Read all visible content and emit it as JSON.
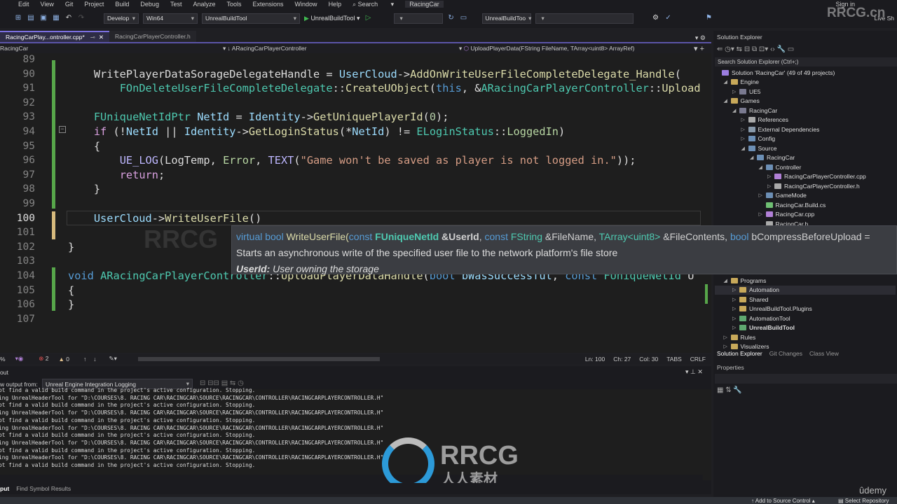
{
  "menu": {
    "items": [
      "Edit",
      "View",
      "Git",
      "Project",
      "Build",
      "Debug",
      "Test",
      "Analyze",
      "Tools",
      "Extensions",
      "Window",
      "Help"
    ],
    "search": "Search",
    "title": "RacingCar",
    "sign_in": "Sign in",
    "live_share": "Live Sh"
  },
  "toolbar": {
    "config": "Develop",
    "platform": "Win64",
    "startup": "UnrealBuildTool",
    "run_label": "UnrealBuildTool",
    "target2": "UnrealBuildToo"
  },
  "tabs": [
    {
      "label": "RacingCarPlay...ontroller.cpp*",
      "active": true
    },
    {
      "label": "RacingCarPlayerController.h",
      "active": false
    }
  ],
  "navbar": {
    "project": "RacingCar",
    "class": "ARacingCarPlayerController",
    "member": "UploadPlayerData(FString FileName, TArray<uint8> ArrayRef)"
  },
  "colors": {
    "p": "#dcdcdc",
    "v": "#9cdcfe",
    "f": "#dcdcaa",
    "t": "#4ec9b0",
    "k": "#569cd6",
    "c": "#d8a0df",
    "m": "#beb7ff",
    "s": "#d69d85",
    "n": "#b5cea8",
    "e": "#b8d7a3",
    "accent": "#7b6fe0"
  },
  "editor": {
    "current_line": 100,
    "lines": [
      {
        "n": 89,
        "t": []
      },
      {
        "n": 90,
        "t": [
          [
            "    WritePlayerDataSorageDelegateHandle",
            "p"
          ],
          [
            " = ",
            "p"
          ],
          [
            "UserCloud",
            "v"
          ],
          [
            "->",
            "p"
          ],
          [
            "AddOnWriteUserFileCompleteDelegate_Handle",
            "f"
          ],
          [
            "(",
            "p"
          ]
        ]
      },
      {
        "n": 91,
        "t": [
          [
            "        ",
            "p"
          ],
          [
            "FOnDeleteUserFileCompleteDelegate",
            "t"
          ],
          [
            "::",
            "p"
          ],
          [
            "CreateUObject",
            "f"
          ],
          [
            "(",
            "p"
          ],
          [
            "this",
            "k"
          ],
          [
            ", &",
            "p"
          ],
          [
            "ARacingCarPlayerController",
            "t"
          ],
          [
            "::",
            "p"
          ],
          [
            "Upload",
            "f"
          ]
        ]
      },
      {
        "n": 92,
        "t": []
      },
      {
        "n": 93,
        "t": [
          [
            "    ",
            "p"
          ],
          [
            "FUniqueNetIdPtr",
            "t"
          ],
          [
            " ",
            "p"
          ],
          [
            "NetId",
            "v"
          ],
          [
            " = ",
            "p"
          ],
          [
            "Identity",
            "v"
          ],
          [
            "->",
            "p"
          ],
          [
            "GetUniquePlayerId",
            "f"
          ],
          [
            "(",
            "p"
          ],
          [
            "0",
            "n"
          ],
          [
            ");",
            "p"
          ]
        ]
      },
      {
        "n": 94,
        "t": [
          [
            "    ",
            "p"
          ],
          [
            "if",
            "c"
          ],
          [
            " (!",
            "p"
          ],
          [
            "NetId",
            "v"
          ],
          [
            " || ",
            "p"
          ],
          [
            "Identity",
            "v"
          ],
          [
            "->",
            "p"
          ],
          [
            "GetLoginStatus",
            "f"
          ],
          [
            "(*",
            "p"
          ],
          [
            "NetId",
            "v"
          ],
          [
            ") != ",
            "p"
          ],
          [
            "ELoginStatus",
            "t"
          ],
          [
            "::",
            "p"
          ],
          [
            "LoggedIn",
            "e"
          ],
          [
            ")",
            "p"
          ]
        ]
      },
      {
        "n": 95,
        "t": [
          [
            "    {",
            "p"
          ]
        ]
      },
      {
        "n": 96,
        "t": [
          [
            "        ",
            "p"
          ],
          [
            "UE_LOG",
            "m"
          ],
          [
            "(",
            "p"
          ],
          [
            "LogTemp",
            "p"
          ],
          [
            ", ",
            "p"
          ],
          [
            "Error",
            "e"
          ],
          [
            ", ",
            "p"
          ],
          [
            "TEXT",
            "m"
          ],
          [
            "(",
            "p"
          ],
          [
            "\"Game won't be saved as player is not logged in.\"",
            "s"
          ],
          [
            "));",
            "p"
          ]
        ]
      },
      {
        "n": 97,
        "t": [
          [
            "        ",
            "p"
          ],
          [
            "return",
            "c"
          ],
          [
            ";",
            "p"
          ]
        ]
      },
      {
        "n": 98,
        "t": [
          [
            "    }",
            "p"
          ]
        ]
      },
      {
        "n": 99,
        "t": []
      },
      {
        "n": 100,
        "t": [
          [
            "    ",
            "p"
          ],
          [
            "UserCloud",
            "v"
          ],
          [
            "->",
            "p"
          ],
          [
            "WriteUserFile",
            "f"
          ],
          [
            "()",
            "p"
          ]
        ]
      },
      {
        "n": 101,
        "t": []
      },
      {
        "n": 102,
        "t": [
          [
            "}",
            "p"
          ]
        ]
      },
      {
        "n": 103,
        "t": []
      },
      {
        "n": 104,
        "t": [
          [
            "void",
            "k"
          ],
          [
            " ",
            "p"
          ],
          [
            "ARacingCarPlayerController",
            "t"
          ],
          [
            "::",
            "p"
          ],
          [
            "UploadPlayerDataHandle",
            "f"
          ],
          [
            "(",
            "p"
          ],
          [
            "bool",
            "k"
          ],
          [
            " ",
            "p"
          ],
          [
            "bWasSuccessful",
            "v"
          ],
          [
            ", ",
            "p"
          ],
          [
            "const",
            "k"
          ],
          [
            " ",
            "p"
          ],
          [
            "FUniqueNetId",
            "t"
          ],
          [
            " U",
            "p"
          ]
        ]
      },
      {
        "n": 105,
        "t": [
          [
            "{",
            "p"
          ]
        ]
      },
      {
        "n": 106,
        "t": [
          [
            "}",
            "p"
          ]
        ]
      },
      {
        "n": 107,
        "t": []
      }
    ]
  },
  "tooltip": {
    "signature": [
      [
        "virtual bool ",
        "k"
      ],
      [
        "WriteUserFile",
        "f"
      ],
      [
        "(",
        "f"
      ],
      [
        "const ",
        "k"
      ],
      [
        "FUniqueNetId",
        "tb"
      ],
      [
        " &UserId",
        "pb"
      ],
      [
        ", ",
        "p"
      ],
      [
        "const ",
        "k"
      ],
      [
        "FString",
        "t"
      ],
      [
        " &FileName, ",
        "p"
      ],
      [
        "TArray",
        "t"
      ],
      [
        "<uint8>",
        "t"
      ],
      [
        " &FileContents, ",
        "p"
      ],
      [
        "bool ",
        "k"
      ],
      [
        "bCompressBeforeUpload =",
        "p"
      ]
    ],
    "description": "Starts an asynchronous write of the specified user file to the network platform's file store",
    "param_name": "UserId:",
    "param_desc": "User owning the storage"
  },
  "editor_status": {
    "zoom": "%",
    "errors": "2",
    "warnings": "0",
    "ln": "Ln: 100",
    "ch": "Ch: 27",
    "col": "Col: 30",
    "tabs": "TABS",
    "eol": "CRLF"
  },
  "output": {
    "title": "out",
    "show_from_label": "w output from:",
    "source": "Unreal Engine Integration Logging",
    "lines": [
      "annot find a valid build command in the project's active configuration. Stopping.",
      "unning UnrealHeaderTool for \"D:\\COURSES\\8. RACING CAR\\RACINGCAR\\SOURCE\\RACINGCAR\\CONTROLLER\\RACINGCARPLAYERCONTROLLER.H\"",
      "annot find a valid build command in the project's active configuration. Stopping.",
      "unning UnrealHeaderTool for \"D:\\COURSES\\8. RACING CAR\\RACINGCAR\\SOURCE\\RACINGCAR\\CONTROLLER\\RACINGCARPLAYERCONTROLLER.H\"",
      "annot find a valid build command in the project's active configuration. Stopping.",
      "unning UnrealHeaderTool for \"D:\\COURSES\\8. RACING CAR\\RACINGCAR\\SOURCE\\RACINGCAR\\CONTROLLER\\RACINGCARPLAYERCONTROLLER.H\"",
      "annot find a valid build command in the project's active configuration. Stopping.",
      "unning UnrealHeaderTool for \"D:\\COURSES\\8. RACING CAR\\RACINGCAR\\SOURCE\\RACINGCAR\\CONTROLLER\\RACINGCARPLAYERCONTROLLER.H\"",
      "annot find a valid build command in the project's active configuration. Stopping.",
      "unning UnrealHeaderTool for \"D:\\COURSES\\8. RACING CAR\\RACINGCAR\\SOURCE\\RACINGCAR\\CONTROLLER\\RACINGCARPLAYERCONTROLLER.H\"",
      "annot find a valid build command in the project's active configuration. Stopping."
    ]
  },
  "bottom_tabs": [
    "put",
    "Find Symbol Results"
  ],
  "statusbar": {
    "source_control": "Add to Source Control",
    "repo": "Select Repository"
  },
  "solution_explorer": {
    "title": "Solution Explorer",
    "search_placeholder": "Search Solution Explorer (Ctrl+;)",
    "tree_top": [
      {
        "label": "Solution 'RacingCar' (49 of 49 projects)",
        "lvl": 0,
        "exp": "",
        "icon": "solution"
      },
      {
        "label": "Engine",
        "lvl": 1,
        "exp": "open",
        "icon": "folder"
      },
      {
        "label": "UE5",
        "lvl": 2,
        "exp": "closed",
        "icon": "project"
      },
      {
        "label": "Games",
        "lvl": 1,
        "exp": "open",
        "icon": "folder"
      },
      {
        "label": "RacingCar",
        "lvl": 2,
        "exp": "open",
        "icon": "project"
      },
      {
        "label": "References",
        "lvl": 3,
        "exp": "closed",
        "icon": "references"
      },
      {
        "label": "External Dependencies",
        "lvl": 3,
        "exp": "closed",
        "icon": "dependencies"
      },
      {
        "label": "Config",
        "lvl": 3,
        "exp": "closed",
        "icon": "filter"
      },
      {
        "label": "Source",
        "lvl": 3,
        "exp": "open",
        "icon": "filter"
      },
      {
        "label": "RacingCar",
        "lvl": 4,
        "exp": "open",
        "icon": "filter"
      },
      {
        "label": "Controller",
        "lvl": 5,
        "exp": "open",
        "icon": "filter"
      },
      {
        "label": "RacingCarPlayerController.cpp",
        "lvl": 6,
        "exp": "closed",
        "icon": "cpp"
      },
      {
        "label": "RacingCarPlayerController.h",
        "lvl": 6,
        "exp": "closed",
        "icon": "header"
      },
      {
        "label": "GameMode",
        "lvl": 5,
        "exp": "closed",
        "icon": "filter"
      },
      {
        "label": "RacingCar.Build.cs",
        "lvl": 5,
        "exp": "",
        "icon": "csharp"
      },
      {
        "label": "RacingCar.cpp",
        "lvl": 5,
        "exp": "closed",
        "icon": "cpp"
      },
      {
        "label": "RacingCar.h",
        "lvl": 5,
        "exp": "",
        "icon": "header"
      }
    ],
    "tree_bottom": [
      {
        "label": "Programs",
        "lvl": 1,
        "exp": "open",
        "icon": "folder"
      },
      {
        "label": "Automation",
        "lvl": 2,
        "exp": "closed",
        "icon": "folder",
        "selected": true
      },
      {
        "label": "Shared",
        "lvl": 2,
        "exp": "closed",
        "icon": "folder"
      },
      {
        "label": "UnrealBuildTool.Plugins",
        "lvl": 2,
        "exp": "closed",
        "icon": "folder"
      },
      {
        "label": "AutomationTool",
        "lvl": 2,
        "exp": "closed",
        "icon": "csproject"
      },
      {
        "label": "UnrealBuildTool",
        "lvl": 2,
        "exp": "closed",
        "icon": "csproject",
        "bold": true
      },
      {
        "label": "Rules",
        "lvl": 1,
        "exp": "closed",
        "icon": "folder"
      },
      {
        "label": "Visualizers",
        "lvl": 1,
        "exp": "closed",
        "icon": "folder"
      }
    ],
    "tabs": [
      "Solution Explorer",
      "Git Changes",
      "Class View"
    ]
  },
  "properties": {
    "title": "Properties"
  },
  "watermarks": {
    "site": "RRCG.cn",
    "logo": "RRCG",
    "logo_cn": "人人素材",
    "udemy": "ûdemy"
  }
}
